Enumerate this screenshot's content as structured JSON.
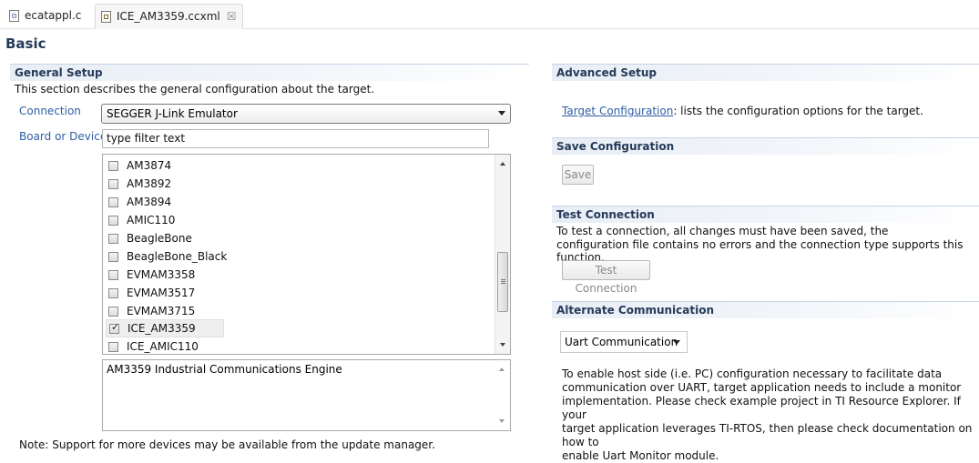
{
  "tabs": [
    {
      "label": "ecatappl.c",
      "icon": "c-file-icon"
    },
    {
      "label": "ICE_AM3359.ccxml",
      "icon": "ccxml-file-icon",
      "close": "☒"
    }
  ],
  "page": {
    "title": "Basic"
  },
  "general_setup": {
    "header": "General Setup",
    "description": "This section describes the general configuration about the target.",
    "connection_label": "Connection",
    "connection_value": "SEGGER J-Link Emulator",
    "board_label": "Board or Device",
    "filter_placeholder": "type filter text",
    "devices": [
      {
        "name": "AM3874",
        "checked": false
      },
      {
        "name": "AM3892",
        "checked": false
      },
      {
        "name": "AM3894",
        "checked": false
      },
      {
        "name": "AMIC110",
        "checked": false
      },
      {
        "name": "BeagleBone",
        "checked": false
      },
      {
        "name": "BeagleBone_Black",
        "checked": false
      },
      {
        "name": "EVMAM3358",
        "checked": false
      },
      {
        "name": "EVMAM3517",
        "checked": false
      },
      {
        "name": "EVMAM3715",
        "checked": false
      },
      {
        "name": "ICE_AM3359",
        "checked": true
      },
      {
        "name": "ICE_AMIC110",
        "checked": false
      }
    ],
    "device_description": "AM3359 Industrial Communications Engine",
    "note": "Note: Support for more devices may be available from the update manager."
  },
  "advanced_setup": {
    "header": "Advanced Setup",
    "target_config_link": "Target Configuration",
    "target_config_text": ": lists the configuration options for the target."
  },
  "save_configuration": {
    "header": "Save Configuration",
    "save_button": "Save"
  },
  "test_connection": {
    "header": "Test Connection",
    "line1": "To test a connection, all changes must have been saved, the",
    "line2": "configuration file contains no errors and the connection type supports this function.",
    "button": "Test Connection"
  },
  "alternate_communication": {
    "header": "Alternate Communication",
    "select_value": "Uart Communication",
    "lines": [
      "To enable host side (i.e. PC) configuration necessary to facilitate data",
      "communication over UART, target application needs to include a monitor",
      "implementation. Please check example project in TI Resource Explorer. If your",
      "target application leverages TI-RTOS, then please check documentation on how to",
      "enable Uart Monitor module."
    ]
  }
}
